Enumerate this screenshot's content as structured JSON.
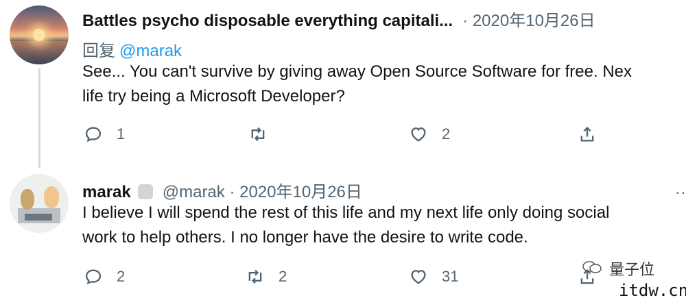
{
  "tweet1": {
    "display_name": "Battles psycho disposable everything capitali...",
    "date": "· 2020年10月26日",
    "reply_label": "回复",
    "reply_to": "@marak",
    "text": "See... You can't survive by giving away Open Source Software for free. Nex\nlife try being a Microsoft Developer?",
    "actions": {
      "replies": "1",
      "retweets": "",
      "likes": "2"
    }
  },
  "tweet2": {
    "display_name": "marak",
    "handle_date": "@marak · 2020年10月26日",
    "text": "I believe I will spend the rest of this life and my next life only doing social\nwork to help others. I no longer have the desire to write code.",
    "actions": {
      "replies": "2",
      "retweets": "2",
      "likes": "31"
    },
    "more": "··"
  },
  "watermark": {
    "label": "量子位",
    "url": "itdw.cn"
  },
  "icons": [
    "reply-icon",
    "retweet-icon",
    "like-icon",
    "share-icon",
    "wechat-icon"
  ]
}
